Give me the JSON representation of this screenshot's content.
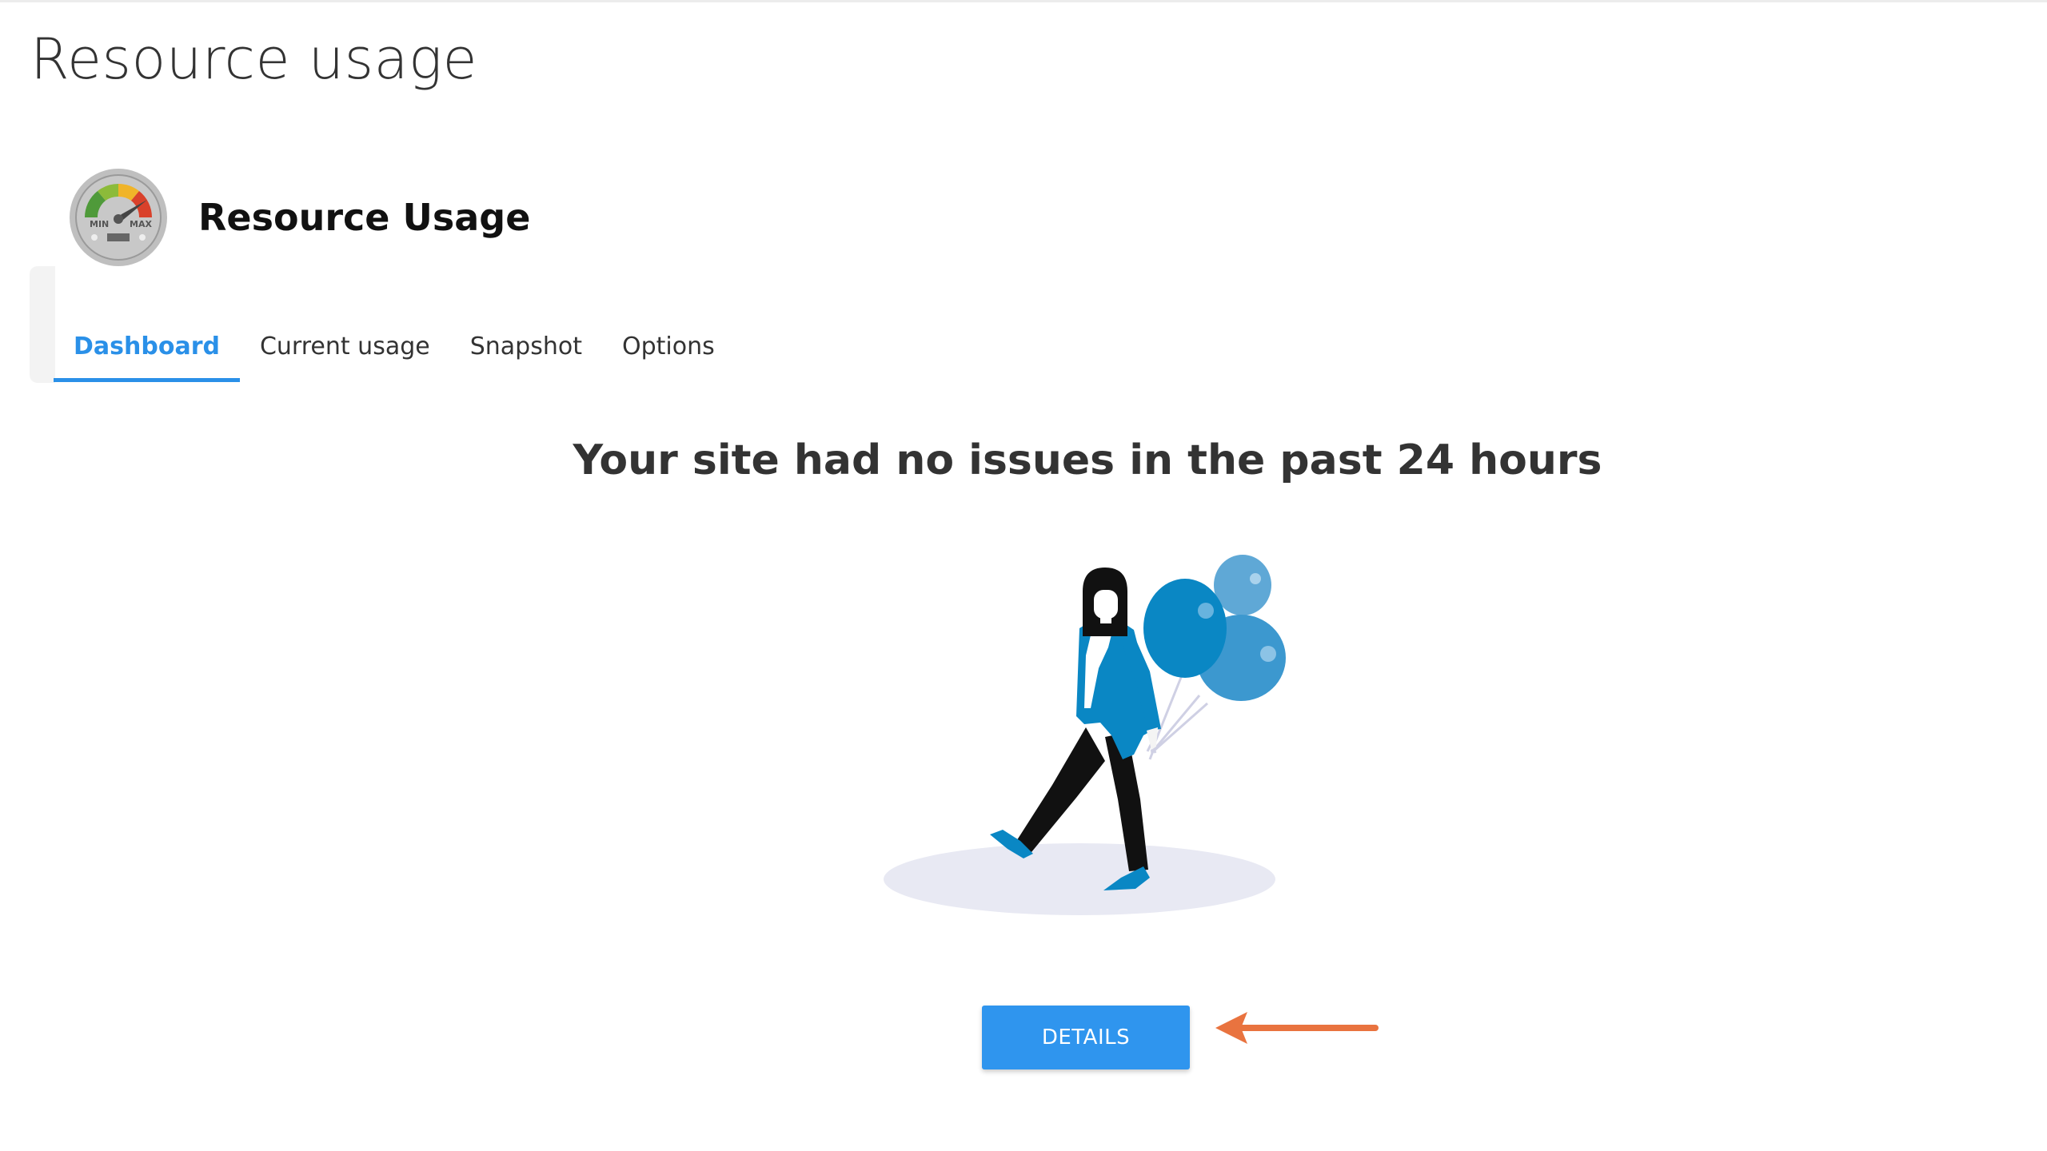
{
  "page": {
    "title": "Resource usage"
  },
  "plugin": {
    "name": "Resource Usage",
    "icon": "gauge-icon",
    "gauge_labels": {
      "min": "MIN",
      "max": "MAX"
    }
  },
  "tabs": [
    {
      "label": "Dashboard",
      "active": true
    },
    {
      "label": "Current usage",
      "active": false
    },
    {
      "label": "Snapshot",
      "active": false
    },
    {
      "label": "Options",
      "active": false
    }
  ],
  "dashboard": {
    "status_message": "Your site had no issues in the past 24 hours",
    "illustration": "woman-with-balloons-illustration",
    "details_button": "DETAILS",
    "pointer": "orange-arrow-icon"
  },
  "colors": {
    "accent_blue": "#2a90e8",
    "button_blue": "#2f95ee",
    "arrow_orange": "#e9733f",
    "balloon_blue": "#0a87c4"
  }
}
